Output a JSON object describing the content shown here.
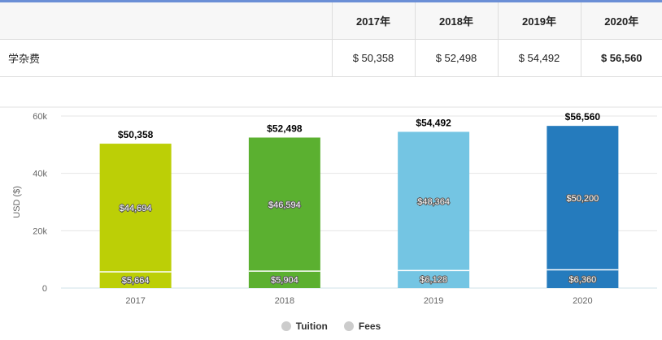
{
  "table": {
    "headers": [
      "2017年",
      "2018年",
      "2019年",
      "2020年"
    ],
    "row_label": "学杂费",
    "values": [
      "$ 50,358",
      "$ 52,498",
      "$ 54,492",
      "$ 56,560"
    ]
  },
  "chart_data": {
    "type": "bar",
    "stacked": true,
    "categories": [
      "2017",
      "2018",
      "2019",
      "2020"
    ],
    "series": [
      {
        "name": "Tuition",
        "values": [
          44694,
          46594,
          48364,
          50200
        ],
        "labels": [
          "$44,694",
          "$46,594",
          "$48,364",
          "$50,200"
        ]
      },
      {
        "name": "Fees",
        "values": [
          5664,
          5904,
          6128,
          6360
        ],
        "labels": [
          "$5,664",
          "$5,904",
          "$6,128",
          "$6,360"
        ]
      }
    ],
    "totals": [
      50358,
      52498,
      54492,
      56560
    ],
    "total_labels": [
      "$50,358",
      "$52,498",
      "$54,492",
      "$56,560"
    ],
    "bar_colors": [
      "#bccf06",
      "#5bb030",
      "#74c5e3",
      "#257bbd"
    ],
    "ylabel": "USD ($)",
    "ylim": [
      0,
      60000
    ],
    "yticks": [
      0,
      20000,
      40000,
      60000
    ],
    "ytick_labels": [
      "0",
      "20k",
      "40k",
      "60k"
    ],
    "grid": true,
    "legend_position": "bottom-center",
    "legend_marker_color": "#cccccc"
  }
}
